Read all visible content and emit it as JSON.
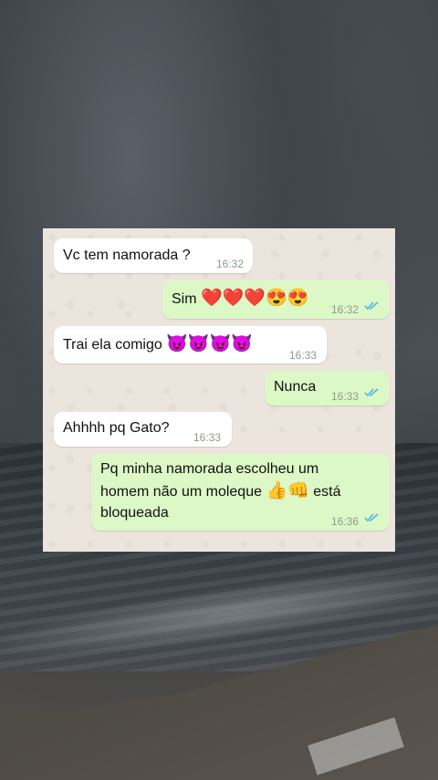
{
  "messages": [
    {
      "direction": "incoming",
      "text": "Vc tem namorada ?",
      "time": "16:32"
    },
    {
      "direction": "outgoing",
      "text": "Sim",
      "emoji": "❤️❤️❤️😍😍",
      "time": "16:32",
      "read": true
    },
    {
      "direction": "incoming",
      "text": "Trai ela comigo",
      "emoji": "😈😈😈😈",
      "time": "16:33"
    },
    {
      "direction": "outgoing",
      "text": "Nunca",
      "time": "16:33",
      "read": true
    },
    {
      "direction": "incoming",
      "text": "Ahhhh pq Gato?",
      "time": "16:33"
    },
    {
      "direction": "outgoing",
      "line1": "Pq minha namorada escolheu um",
      "line2_a": "homem não um moleque",
      "line2_emoji": "👍👊",
      "line2_b": "está",
      "line3": "bloqueada",
      "time": "16:36",
      "read": true
    }
  ],
  "colors": {
    "incoming_bubble": "#ffffff",
    "outgoing_bubble": "#dcf8c6",
    "chat_background": "#ece5dd",
    "read_tick": "#4fb6ec",
    "timestamp": "#8d9a93"
  },
  "icons": {
    "read_receipt": "double-check-icon"
  }
}
